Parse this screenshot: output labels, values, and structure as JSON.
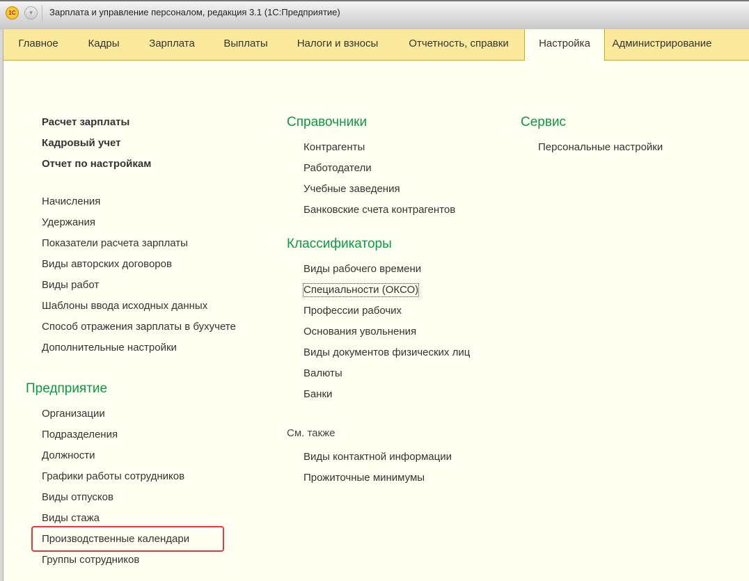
{
  "window": {
    "title": "Зарплата и управление персоналом, редакция 3.1  (1С:Предприятие)",
    "logo": "1С"
  },
  "tabs": [
    "Главное",
    "Кадры",
    "Зарплата",
    "Выплаты",
    "Налоги и взносы",
    "Отчетность, справки",
    "Настройка",
    "Администрирование"
  ],
  "active_tab": "Настройка",
  "left": {
    "bold_items": [
      "Расчет зарплаты",
      "Кадровый учет",
      "Отчет по настройкам"
    ],
    "items": [
      "Начисления",
      "Удержания",
      "Показатели расчета зарплаты",
      "Виды авторских договоров",
      "Виды работ",
      "Шаблоны ввода исходных данных",
      "Способ отражения зарплаты в бухучете",
      "Дополнительные настройки"
    ],
    "enterprise_heading": "Предприятие",
    "enterprise_items": [
      "Организации",
      "Подразделения",
      "Должности",
      "Графики работы сотрудников",
      "Виды отпусков",
      "Виды стажа",
      "Производственные календари",
      "Группы сотрудников"
    ]
  },
  "middle": {
    "ref_heading": "Справочники",
    "ref_items": [
      "Контрагенты",
      "Работодатели",
      "Учебные заведения",
      "Банковские счета контрагентов"
    ],
    "class_heading": "Классификаторы",
    "class_items": [
      "Виды рабочего времени",
      "Специальности (ОКСО)",
      "Профессии рабочих",
      "Основания увольнения",
      "Виды документов физических лиц",
      "Валюты",
      "Банки"
    ],
    "see_also": "См. также",
    "see_also_items": [
      "Виды контактной информации",
      "Прожиточные минимумы"
    ]
  },
  "right": {
    "heading": "Сервис",
    "items": [
      "Персональные настройки"
    ]
  },
  "colors": {
    "tabbar": "#fbea9b",
    "heading": "#0a9a44",
    "highlight": "#e03a3a",
    "background": "#fffff2"
  }
}
